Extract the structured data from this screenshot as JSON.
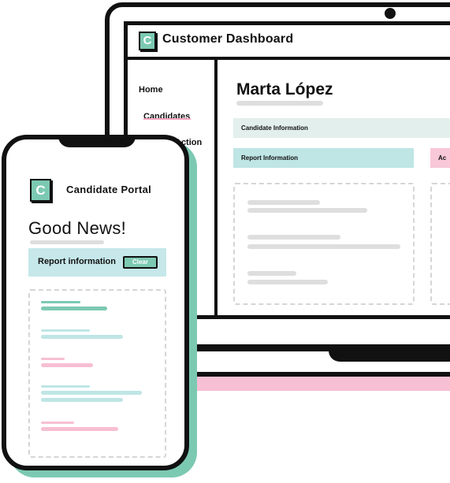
{
  "dashboard": {
    "logo_letter": "C",
    "title": "Customer Dashboard",
    "nav": [
      "Home",
      "Candidates",
      "Action"
    ],
    "candidate_name": "Marta López",
    "candidate_info_label": "Candidate Information",
    "report_info_label": "Report Information",
    "side_label": "Ac"
  },
  "phone": {
    "logo_letter": "C",
    "portal_title": "Candidate Portal",
    "headline": "Good News!",
    "report_label": "Report information",
    "clear_label": "Clear"
  },
  "colors": {
    "teal": "#7cc9b2",
    "light_teal": "#c6e8ea",
    "pink": "#f7bfd3",
    "ink": "#111111"
  }
}
